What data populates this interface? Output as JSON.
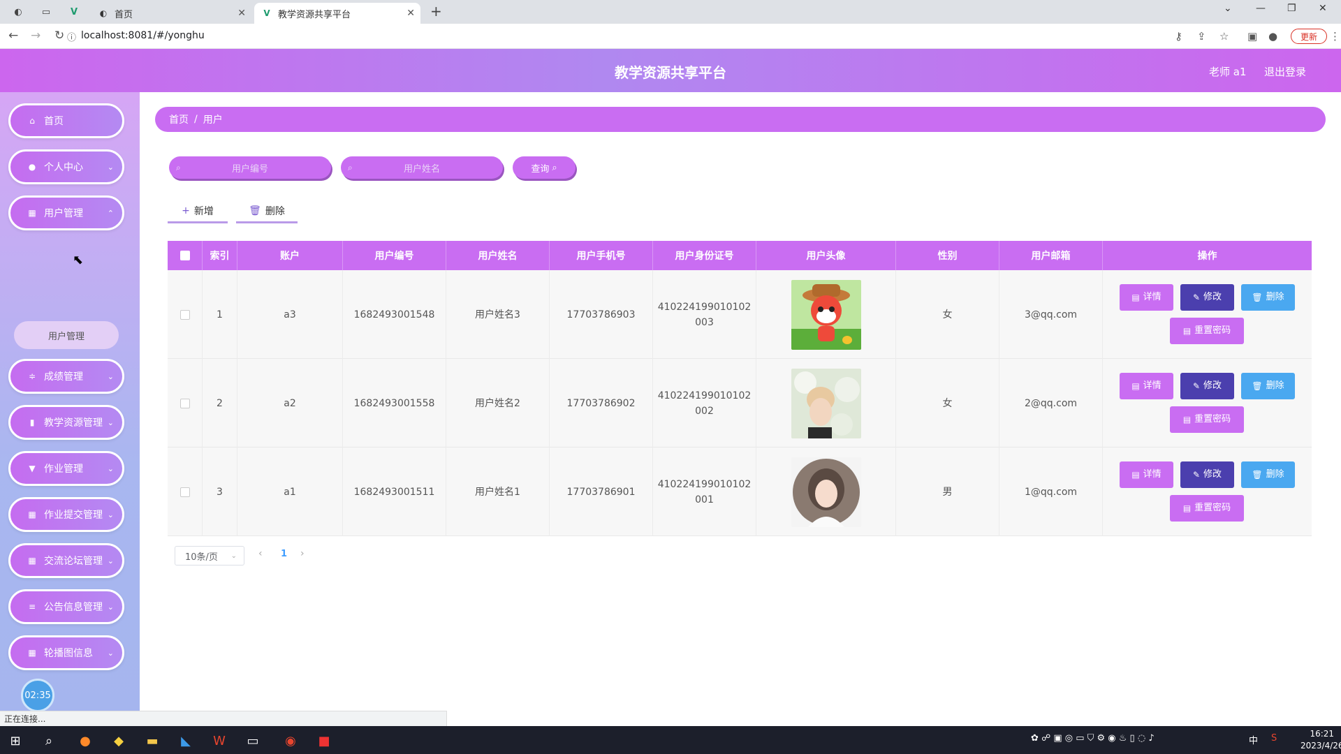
{
  "browser": {
    "tabs": [
      {
        "title": "首页",
        "active": false
      },
      {
        "title": "教学资源共享平台",
        "active": true
      }
    ],
    "url": "localhost:8081/#/yonghu",
    "update_label": "更新",
    "status_text": "正在连接..."
  },
  "header": {
    "title": "教学资源共享平台",
    "user": "老师 a1",
    "logout": "退出登录"
  },
  "sidebar": {
    "items": [
      {
        "label": "首页",
        "icon": "home-icon"
      },
      {
        "label": "个人中心",
        "icon": "user-icon"
      },
      {
        "label": "用户管理",
        "icon": "grid-icon"
      },
      {
        "label": "成绩管理",
        "icon": "sliders-icon"
      },
      {
        "label": "教学资源管理",
        "icon": "chart-icon"
      },
      {
        "label": "作业管理",
        "icon": "pin-icon"
      },
      {
        "label": "作业提交管理",
        "icon": "grid-icon"
      },
      {
        "label": "交流论坛管理",
        "icon": "grid-icon"
      },
      {
        "label": "公告信息管理",
        "icon": "list-icon"
      },
      {
        "label": "轮播图信息",
        "icon": "grid-icon"
      }
    ],
    "submenu": "用户管理",
    "clock": "02:35"
  },
  "breadcrumb": {
    "home": "首页",
    "sep": "/",
    "current": "用户"
  },
  "search": {
    "field1_placeholder": "用户编号",
    "field2_placeholder": "用户姓名",
    "query_label": "查询"
  },
  "actions": {
    "add": "新增",
    "delete": "删除"
  },
  "table": {
    "columns": [
      "索引",
      "账户",
      "用户编号",
      "用户姓名",
      "用户手机号",
      "用户身份证号",
      "用户头像",
      "性别",
      "用户邮箱",
      "操作"
    ],
    "rows": [
      {
        "index": "1",
        "account": "a3",
        "number": "1682493001548",
        "name": "用户姓名3",
        "phone": "17703786903",
        "id_line1": "410224199010102",
        "id_line2": "003",
        "avatar": "cartoon-fox-avatar",
        "gender": "女",
        "email": "3@qq.com"
      },
      {
        "index": "2",
        "account": "a2",
        "number": "1682493001558",
        "name": "用户姓名2",
        "phone": "17703786902",
        "id_line1": "410224199010102",
        "id_line2": "002",
        "avatar": "photo-portrait-avatar",
        "gender": "女",
        "email": "2@qq.com"
      },
      {
        "index": "3",
        "account": "a1",
        "number": "1682493001511",
        "name": "用户姓名1",
        "phone": "17703786901",
        "id_line1": "410224199010102",
        "id_line2": "001",
        "avatar": "illustrated-girl-avatar",
        "gender": "男",
        "email": "1@qq.com"
      }
    ],
    "buttons": {
      "detail": "详情",
      "edit": "修改",
      "delete": "删除",
      "reset": "重置密码"
    }
  },
  "pagination": {
    "page_size": "10条/页",
    "current_page": "1"
  },
  "taskbar": {
    "time": "16:21",
    "date": "2023/4/26",
    "ime": "中"
  }
}
